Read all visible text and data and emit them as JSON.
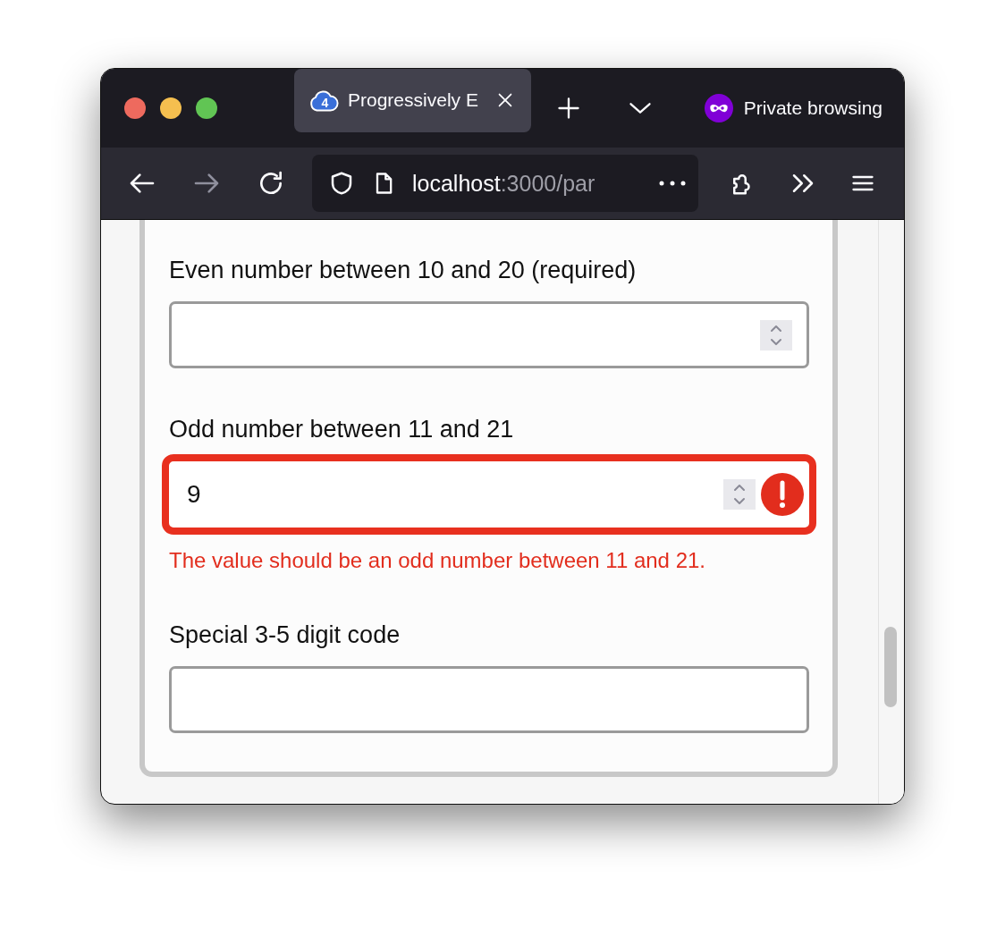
{
  "browser": {
    "tab": {
      "title": "Progressively E",
      "icon_label": "4",
      "selected": true
    },
    "private_label": "Private browsing",
    "url_host": "localhost",
    "url_path": ":3000/par"
  },
  "form": {
    "fields": [
      {
        "label": "Even number between 10 and 20 (required)",
        "kind": "number",
        "invalid": false
      },
      {
        "label": "Odd number between 11 and 21",
        "kind": "number",
        "value": "9",
        "invalid": true,
        "error": "The value should be an odd number between 11 and 21."
      },
      {
        "label": "Special 3-5 digit code",
        "kind": "text",
        "invalid": false
      }
    ]
  }
}
